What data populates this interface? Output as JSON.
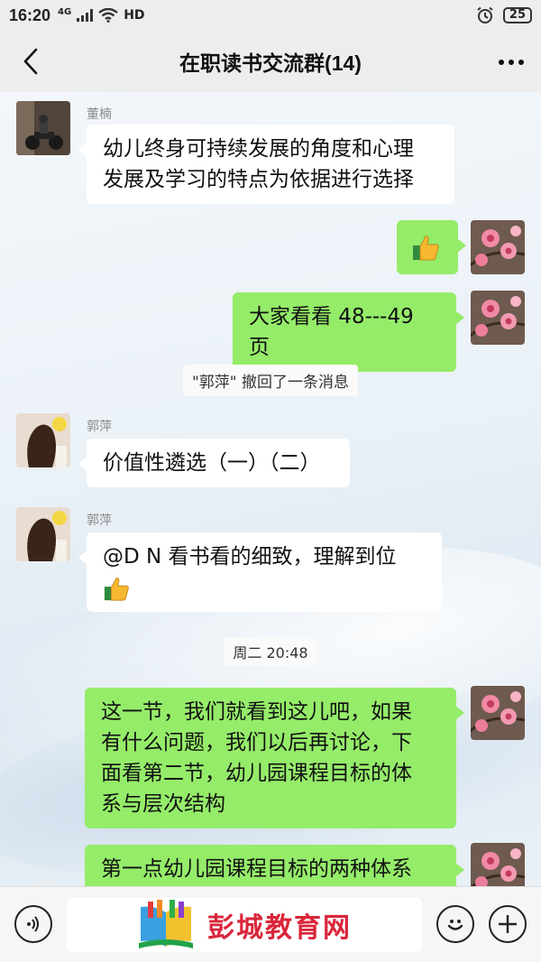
{
  "status_bar": {
    "time": "16:20",
    "network": "4G",
    "hd": "HD",
    "battery": "25"
  },
  "header": {
    "title": "在职读书交流群(14)"
  },
  "messages": [
    {
      "sender": "董楠",
      "side": "left",
      "avatar": "motorcycle-photo-avatar",
      "lines": [
        "幼儿终身可持续发展的角度和心理",
        "发展及学习的特点为依据进行选择"
      ]
    },
    {
      "side": "right",
      "avatar": "pink-flower-avatar",
      "emoji": "thumbs-up"
    },
    {
      "side": "right",
      "avatar": "pink-flower-avatar",
      "text": "大家看看 48---49 页"
    },
    {
      "side": "left",
      "sender": "郭萍",
      "avatar": "girl-hair-avatar",
      "text": "价值性遴选（一）（二）"
    },
    {
      "side": "left",
      "sender": "郭萍",
      "avatar": "girl-hair-avatar",
      "text": "@D N  看书看的细致，理解到位",
      "emoji": "thumbs-up"
    },
    {
      "side": "right",
      "avatar": "pink-flower-avatar",
      "lines": [
        "这一节，我们就看到这儿吧，如果",
        "有什么问题，我们以后再讨论，下",
        "面看第二节，幼儿园课程目标的体",
        "系与层次结构"
      ]
    },
    {
      "side": "right",
      "avatar": "pink-flower-avatar",
      "text": "第一点幼儿园课程目标的两种体系"
    }
  ],
  "system": {
    "recall_notice": "\"郭萍\" 撤回了一条消息",
    "timestamp": "周二 20:48"
  },
  "watermark": {
    "text": "彭城教育网"
  },
  "colors": {
    "green_bubble": "#95ec69",
    "white_bubble": "#ffffff",
    "watermark_red": "#d9263a"
  }
}
